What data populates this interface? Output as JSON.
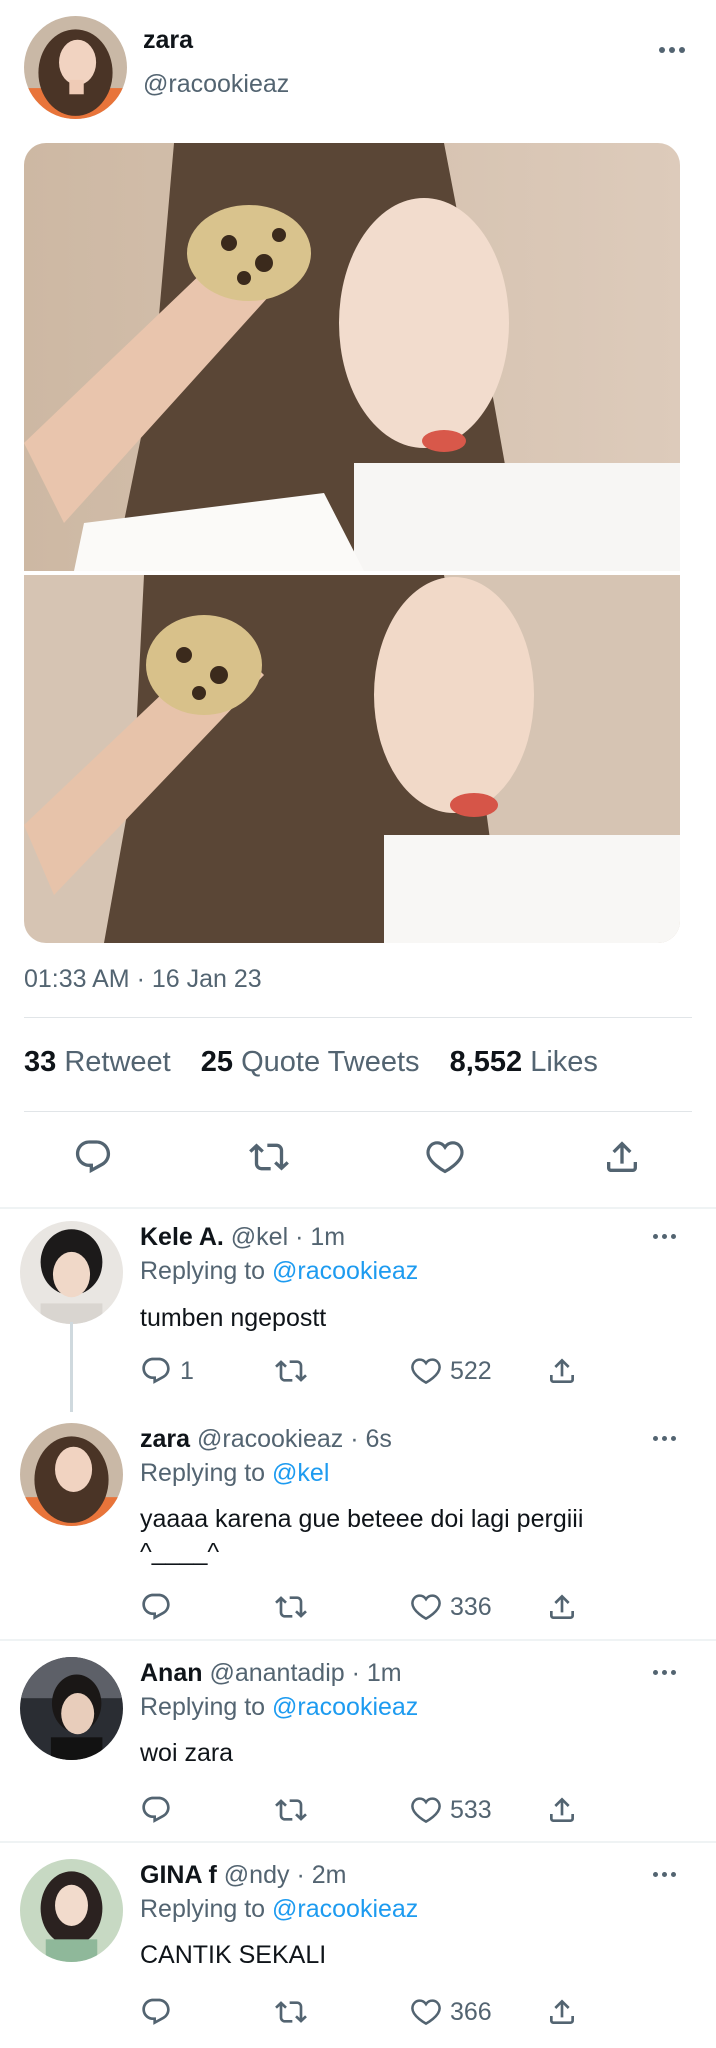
{
  "main_tweet": {
    "name": "zara",
    "handle": "@racookieaz",
    "timestamp": "01:33 AM · 16 Jan 23",
    "stats": {
      "retweets_count": "33",
      "retweets_label": "Retweet",
      "quotes_count": "25",
      "quotes_label": "Quote Tweets",
      "likes_count": "8,552",
      "likes_label": "Likes"
    },
    "actions": [
      "reply-icon",
      "retweet-icon",
      "like-icon",
      "share-icon"
    ]
  },
  "replies": [
    {
      "name": "Kele A.",
      "handle": "@kel",
      "time": "· 1m",
      "replying_prefix": "Replying to",
      "replying_to": "@racookieaz",
      "text": "tumben ngepostt",
      "reply_count": "1",
      "like_count": "522"
    },
    {
      "name": "zara",
      "handle": "@racookieaz",
      "time": "· 6s",
      "replying_prefix": "Replying to",
      "replying_to": "@kel",
      "text": "yaaaa karena gue beteee doi lagi pergiii ^____^",
      "reply_count": "",
      "like_count": "336"
    },
    {
      "name": "Anan",
      "handle": "@anantadip",
      "time": "· 1m",
      "replying_prefix": "Replying to",
      "replying_to": "@racookieaz",
      "text": "woi zara",
      "reply_count": "",
      "like_count": "533"
    },
    {
      "name": "GINA f",
      "handle": "@ndy",
      "time": "· 2m",
      "replying_prefix": "Replying to",
      "replying_to": "@racookieaz",
      "text": "CANTIK SEKALI",
      "reply_count": "",
      "like_count": "366"
    }
  ],
  "colors": {
    "text": "#0f1419",
    "muted": "#536471",
    "link": "#1d9bf0",
    "divider": "#e1e5e8"
  }
}
